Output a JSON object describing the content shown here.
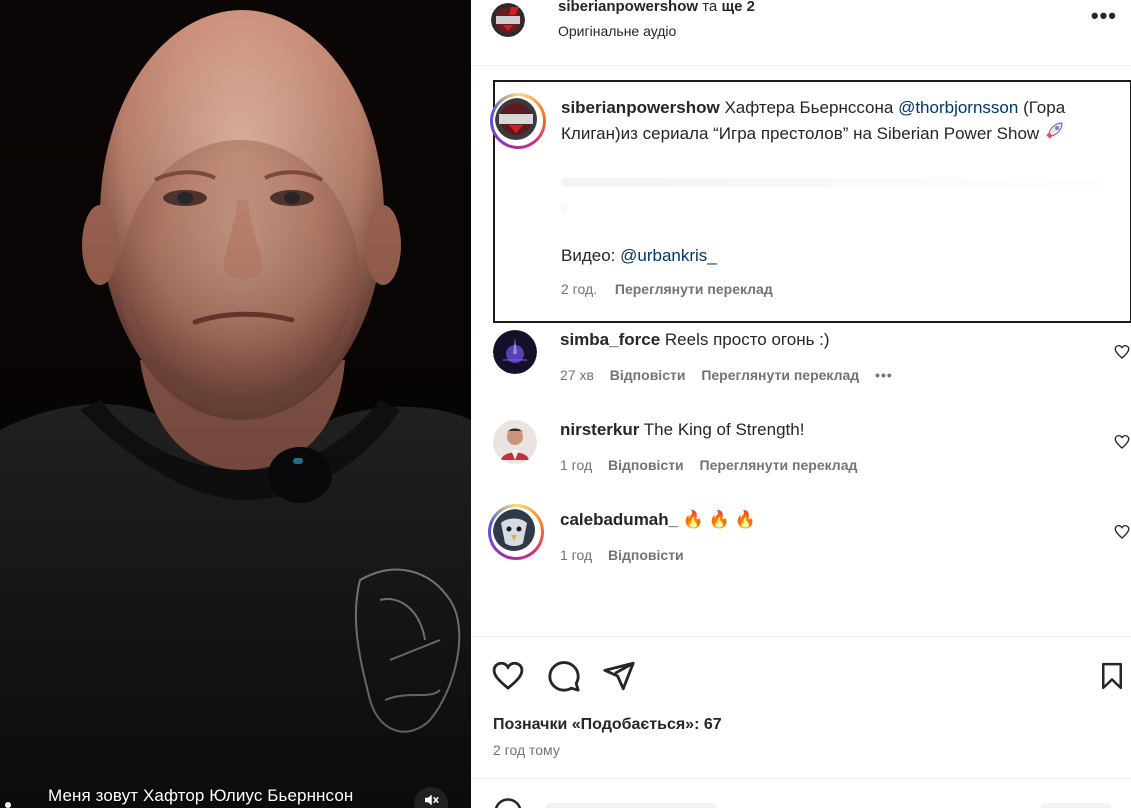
{
  "video": {
    "caption": "Меня зовут Хафтор Юлиус Бьерннсон",
    "mute_icon": "speaker-muted-icon"
  },
  "header": {
    "username": "siberianpowershow",
    "and_text": "та",
    "others": "ще 2",
    "audio": "Оригінальне аудіо",
    "more_icon": "more-horizontal-icon",
    "more_label": "•••"
  },
  "caption": {
    "username": "siberianpowershow",
    "text_1": "Хафтера Бьернссона",
    "mention_1": "@thorbjornsson",
    "text_2": "(Гора Клиган)из сериала “Игра престолов” на Siberian Power Show",
    "credit_prefix": "Видео:",
    "credit_mention": "@urbankris_",
    "time": "2 год.",
    "translate": "Переглянути переклад"
  },
  "comments": [
    {
      "username": "simba_force",
      "text": "Reels просто огонь :)",
      "time": "27 хв",
      "reply": "Відповісти",
      "translate": "Переглянути переклад",
      "more": "•••"
    },
    {
      "username": "nirsterkur",
      "text": "The King of Strength!",
      "time": "1 год",
      "reply": "Відповісти",
      "translate": "Переглянути переклад"
    },
    {
      "username": "calebadumah_",
      "text": "🔥 🔥 🔥",
      "time": "1 год",
      "reply": "Відповісти"
    }
  ],
  "actions": {
    "like_icon": "heart-icon",
    "comment_icon": "comment-bubble-icon",
    "share_icon": "paper-plane-icon",
    "save_icon": "bookmark-icon"
  },
  "likes": {
    "label": "Позначки «Подобається»: 67"
  },
  "post_time": "2 год тому",
  "colors": {
    "mention": "#00376b",
    "muted_text": "#737373",
    "text": "#262626"
  }
}
